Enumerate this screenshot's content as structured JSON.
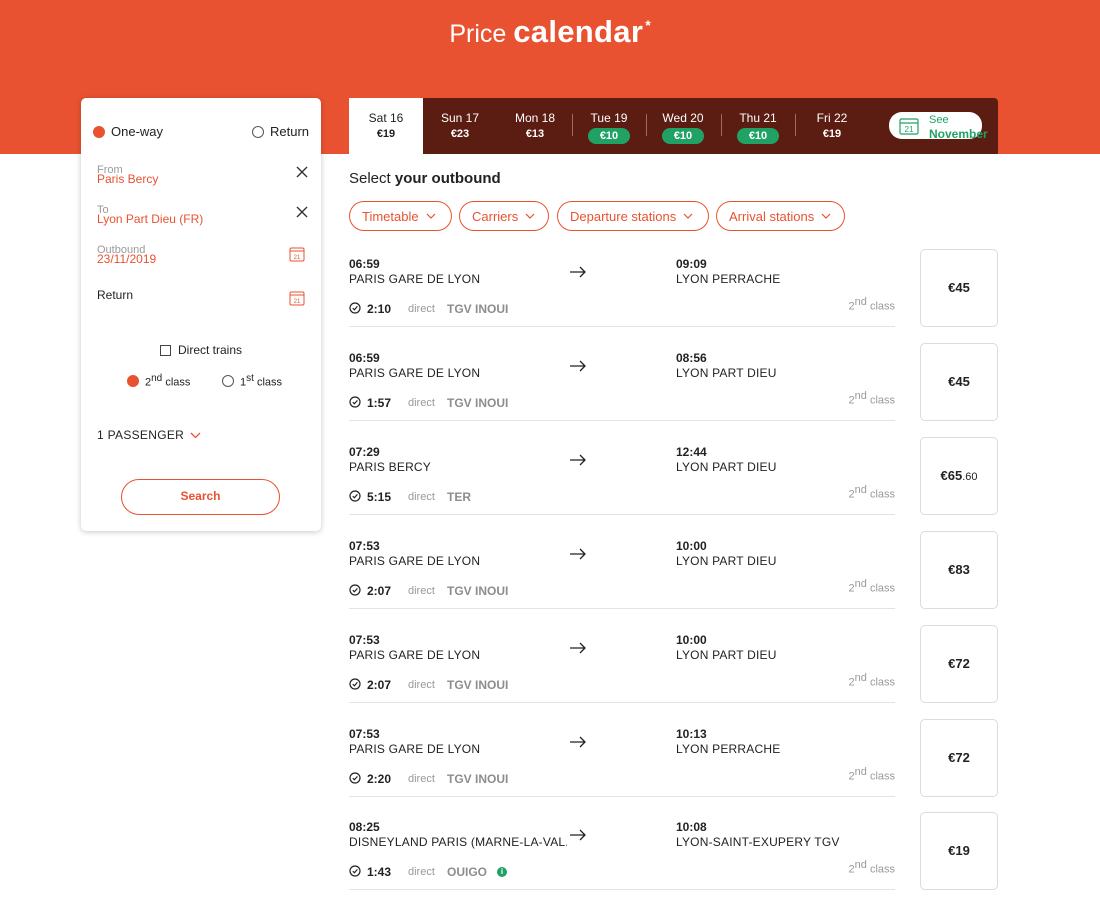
{
  "header": {
    "title_light": "Price",
    "title_bold": "calendar",
    "title_mark": "*"
  },
  "search": {
    "one_way": "One-way",
    "return": "Return",
    "from_label": "From",
    "from_value": "Paris Bercy",
    "to_label": "To",
    "to_value": "Lyon Part Dieu (FR)",
    "outbound_label": "Outbound",
    "outbound_value": "23/11/2019",
    "return_label": "Return",
    "direct_trains": "Direct trains",
    "class_2_num": "2",
    "class_2_sup": "nd",
    "class_2_word": "class",
    "class_1_num": "1",
    "class_1_sup": "st",
    "class_1_word": "class",
    "passengers": "1 PASSENGER",
    "search_button": "Search",
    "colors": {
      "accent": "#e95231",
      "dark": "#5b1c12",
      "green": "#21a265"
    }
  },
  "dates": [
    {
      "day": "Sat 16",
      "price": "€19",
      "selected": true,
      "cheap": false
    },
    {
      "day": "Sun 17",
      "price": "€23",
      "selected": false,
      "cheap": false
    },
    {
      "day": "Mon 18",
      "price": "€13",
      "selected": false,
      "cheap": false
    },
    {
      "day": "Tue 19",
      "price": "€10",
      "selected": false,
      "cheap": true
    },
    {
      "day": "Wed 20",
      "price": "€10",
      "selected": false,
      "cheap": true
    },
    {
      "day": "Thu 21",
      "price": "€10",
      "selected": false,
      "cheap": true
    },
    {
      "day": "Fri 22",
      "price": "€19",
      "selected": false,
      "cheap": false
    }
  ],
  "see_more": {
    "line1": "See",
    "line2": "November",
    "icon_num": "21"
  },
  "results": {
    "heading_light": "Select",
    "heading_bold": "your outbound",
    "filters": [
      "Timetable",
      "Carriers",
      "Departure stations",
      "Arrival stations"
    ],
    "direct_label": "direct",
    "class_num": "2",
    "class_sup": "nd",
    "class_word": "class",
    "journeys": [
      {
        "dep_time": "06:59",
        "dep_station": "PARIS GARE DE LYON",
        "arr_time": "09:09",
        "arr_station": "LYON PERRACHE",
        "duration": "2:10",
        "carrier": "TGV INOUI",
        "price_main": "€45",
        "price_cents": ""
      },
      {
        "dep_time": "06:59",
        "dep_station": "PARIS GARE DE LYON",
        "arr_time": "08:56",
        "arr_station": "LYON PART DIEU",
        "duration": "1:57",
        "carrier": "TGV INOUI",
        "price_main": "€45",
        "price_cents": ""
      },
      {
        "dep_time": "07:29",
        "dep_station": "PARIS BERCY",
        "arr_time": "12:44",
        "arr_station": "LYON PART DIEU",
        "duration": "5:15",
        "carrier": "TER",
        "price_main": "€65",
        "price_cents": ".60"
      },
      {
        "dep_time": "07:53",
        "dep_station": "PARIS GARE DE LYON",
        "arr_time": "10:00",
        "arr_station": "LYON PART DIEU",
        "duration": "2:07",
        "carrier": "TGV INOUI",
        "price_main": "€83",
        "price_cents": ""
      },
      {
        "dep_time": "07:53",
        "dep_station": "PARIS GARE DE LYON",
        "arr_time": "10:00",
        "arr_station": "LYON PART DIEU",
        "duration": "2:07",
        "carrier": "TGV INOUI",
        "price_main": "€72",
        "price_cents": ""
      },
      {
        "dep_time": "07:53",
        "dep_station": "PARIS GARE DE LYON",
        "arr_time": "10:13",
        "arr_station": "LYON PERRACHE",
        "duration": "2:20",
        "carrier": "TGV INOUI",
        "price_main": "€72",
        "price_cents": ""
      },
      {
        "dep_time": "08:25",
        "dep_station": "DISNEYLAND PARIS (MARNE-LA-VAL...",
        "arr_time": "10:08",
        "arr_station": "LYON-SAINT-EXUPERY TGV",
        "duration": "1:43",
        "carrier": "OUIGO",
        "price_main": "€19",
        "price_cents": "",
        "info": true
      }
    ]
  }
}
